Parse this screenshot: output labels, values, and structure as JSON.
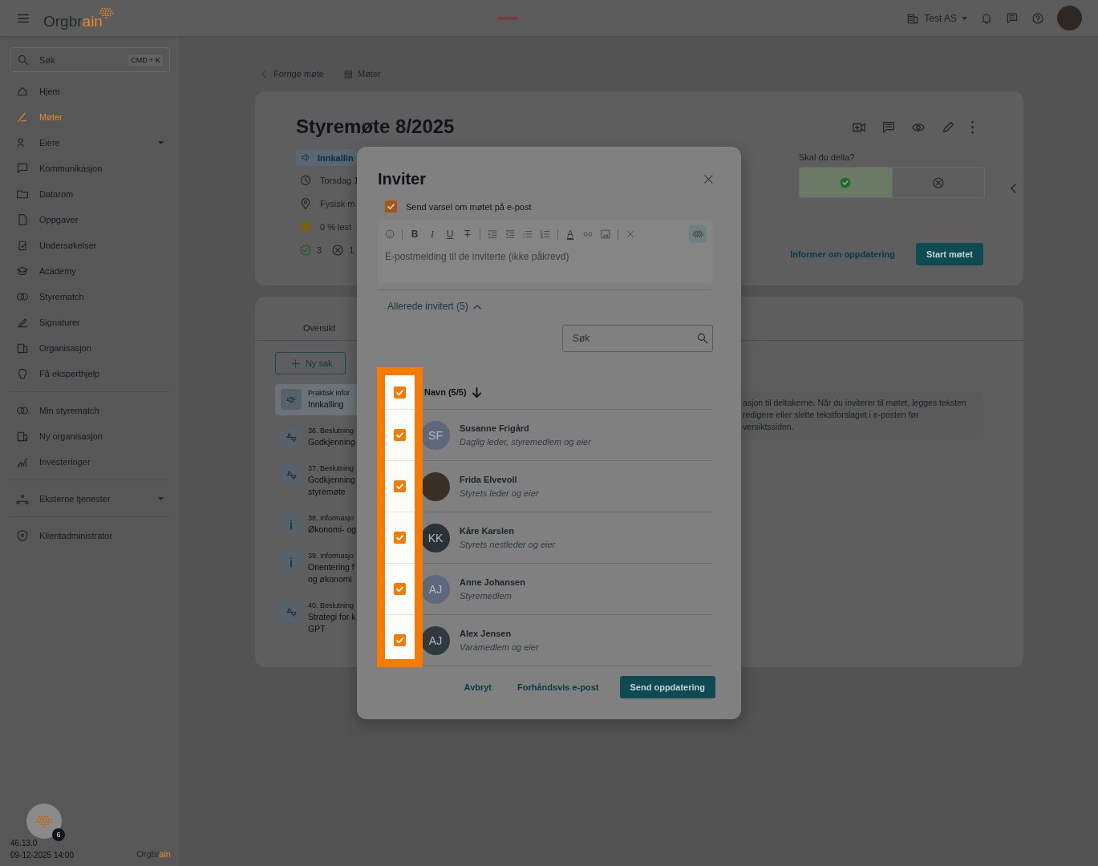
{
  "topbar": {
    "logo": {
      "parts": [
        {
          "text": "Orgbr",
          "accent": false
        },
        {
          "text": "ain",
          "accent": true
        }
      ]
    },
    "organization": "Test AS"
  },
  "sidebar": {
    "search": {
      "placeholder": "Søk",
      "shortcut": "CMD + K"
    },
    "groups": [
      {
        "items": [
          {
            "label": "Hjem",
            "selected": false,
            "expandable": false
          },
          {
            "label": "Møter",
            "selected": true,
            "expandable": false
          },
          {
            "label": "Eiere",
            "selected": false,
            "expandable": true
          },
          {
            "label": "Kommunikasjon",
            "selected": false,
            "expandable": false
          },
          {
            "label": "Datarom",
            "selected": false,
            "expandable": false
          },
          {
            "label": "Oppgaver",
            "selected": false,
            "expandable": false
          },
          {
            "label": "Undersøkelser",
            "selected": false,
            "expandable": false
          },
          {
            "label": "Academy",
            "selected": false,
            "expandable": false
          },
          {
            "label": "Styrematch",
            "selected": false,
            "expandable": false
          },
          {
            "label": "Signaturer",
            "selected": false,
            "expandable": false
          },
          {
            "label": "Organisasjon",
            "selected": false,
            "expandable": false
          },
          {
            "label": "Få eksperthjelp",
            "selected": false,
            "expandable": false
          }
        ]
      },
      {
        "items": [
          {
            "label": "Min styrematch",
            "selected": false,
            "expandable": false
          },
          {
            "label": "Ny organisasjon",
            "selected": false,
            "expandable": false
          },
          {
            "label": "Investeringer",
            "selected": false,
            "expandable": false
          }
        ]
      },
      {
        "items": [
          {
            "label": "Eksterne tjenester",
            "selected": false,
            "expandable": true
          }
        ]
      },
      {
        "items": [
          {
            "label": "Klientadministrator",
            "selected": false,
            "expandable": false
          }
        ]
      }
    ],
    "footer": {
      "badge": "6",
      "version": "46.13.0",
      "timestamp": "09-12-2025 14:00",
      "logo": {
        "parts": [
          {
            "text": "Orgbr",
            "accent": false
          },
          {
            "text": "ain",
            "accent": true
          }
        ]
      }
    }
  },
  "breadcrumb": [
    "Forrige møte",
    "Møter"
  ],
  "meeting": {
    "title": "Styremøte 8/2025",
    "tag": "Innkallin",
    "details": [
      {
        "kind": "time",
        "text": "Torsdag 1"
      },
      {
        "kind": "place",
        "text": "Fysisk m"
      },
      {
        "kind": "read",
        "text": "0 % lest"
      }
    ],
    "responses": [
      {
        "kind": "yes",
        "count": "3"
      },
      {
        "kind": "no",
        "count": "1"
      }
    ],
    "attend": {
      "question": "Skal du delta?",
      "options": [
        {
          "kind": "yes",
          "selected": true
        },
        {
          "kind": "no",
          "selected": false
        }
      ]
    },
    "inform_link": "Informer om oppdatering",
    "start_button": "Start møtet"
  },
  "agenda": {
    "tabs": [
      {
        "label": "Oversikt",
        "selected": false
      }
    ],
    "new_button": "Ny sak",
    "items": [
      {
        "kind": "notice",
        "category": "Praktisk infor",
        "lines": [
          "Innkalling"
        ],
        "selected": true
      },
      {
        "kind": "decision",
        "category": "36. Beslutning",
        "lines": [
          "Godkjenning"
        ],
        "selected": false
      },
      {
        "kind": "decision",
        "category": "37. Beslutning",
        "lines": [
          "Godkjenning",
          "styremøte"
        ],
        "selected": false
      },
      {
        "kind": "info",
        "category": "38. Informasjo",
        "lines": [
          "Økonomi- og"
        ],
        "selected": false
      },
      {
        "kind": "info",
        "category": "39. Informasjo",
        "lines": [
          "Orientering f",
          "og økonomi"
        ],
        "selected": false
      },
      {
        "kind": "decision",
        "category": "40. Beslutning",
        "lines": [
          "Strategi for k",
          "GPT"
        ],
        "selected": false
      }
    ],
    "info_lines": [
      "asjon til deltakerne. Når du inviterer til møtet, legges teksten",
      "redigere eller slette tekstforslaget i e-posten før",
      "versiktssiden."
    ]
  },
  "dialog": {
    "title": "Inviter",
    "notify": {
      "label": "Send varsel om møtet på e-post",
      "checked": true
    },
    "editor": {
      "placeholder": "E-postmelding til de inviterte (ikke påkrevd)",
      "tools": [
        {
          "kind": "emoji"
        },
        {
          "kind": "sep"
        },
        {
          "kind": "bold",
          "text": "B"
        },
        {
          "kind": "italic",
          "text": "I"
        },
        {
          "kind": "underline",
          "text": "U"
        },
        {
          "kind": "strike",
          "text": "T"
        },
        {
          "kind": "sep"
        },
        {
          "kind": "indent"
        },
        {
          "kind": "outdent"
        },
        {
          "kind": "bullets"
        },
        {
          "kind": "numbers"
        },
        {
          "kind": "sep"
        },
        {
          "kind": "text-color",
          "text": "A"
        },
        {
          "kind": "link"
        },
        {
          "kind": "image"
        },
        {
          "kind": "sep"
        },
        {
          "kind": "clear"
        }
      ]
    },
    "invited": {
      "label": "Allerede invitert (5)",
      "expanded": true
    },
    "search": {
      "placeholder": "Søk"
    },
    "table": {
      "header": {
        "label": "Navn (5/5)",
        "checked": true
      },
      "rows": [
        {
          "kind": "initials",
          "initials": "SF",
          "color": "#5d687c",
          "name": "Susanne Frigård",
          "role": "Daglig leder, styremedlem og eier",
          "checked": true
        },
        {
          "kind": "photo",
          "name": "Frida Elvevoll",
          "role": "Styrets leder og eier",
          "checked": true
        },
        {
          "kind": "initials",
          "initials": "KK",
          "color": "#2a3236",
          "name": "Kåre Karslen",
          "role": "Styrets nestleder og eier",
          "checked": true
        },
        {
          "kind": "initials",
          "initials": "AJ",
          "color": "#5d687c",
          "name": "Anne Johansen",
          "role": "Styremedlem",
          "checked": true
        },
        {
          "kind": "initials",
          "initials": "AJ",
          "color": "#2f3a40",
          "name": "Alex Jensen",
          "role": "Varamedlem og eier",
          "checked": true
        }
      ]
    },
    "buttons": [
      {
        "kind": "text",
        "label": "Avbryt"
      },
      {
        "kind": "text",
        "label": "Forhåndsvis e-post"
      },
      {
        "kind": "primary",
        "label": "Send oppdatering"
      }
    ]
  }
}
